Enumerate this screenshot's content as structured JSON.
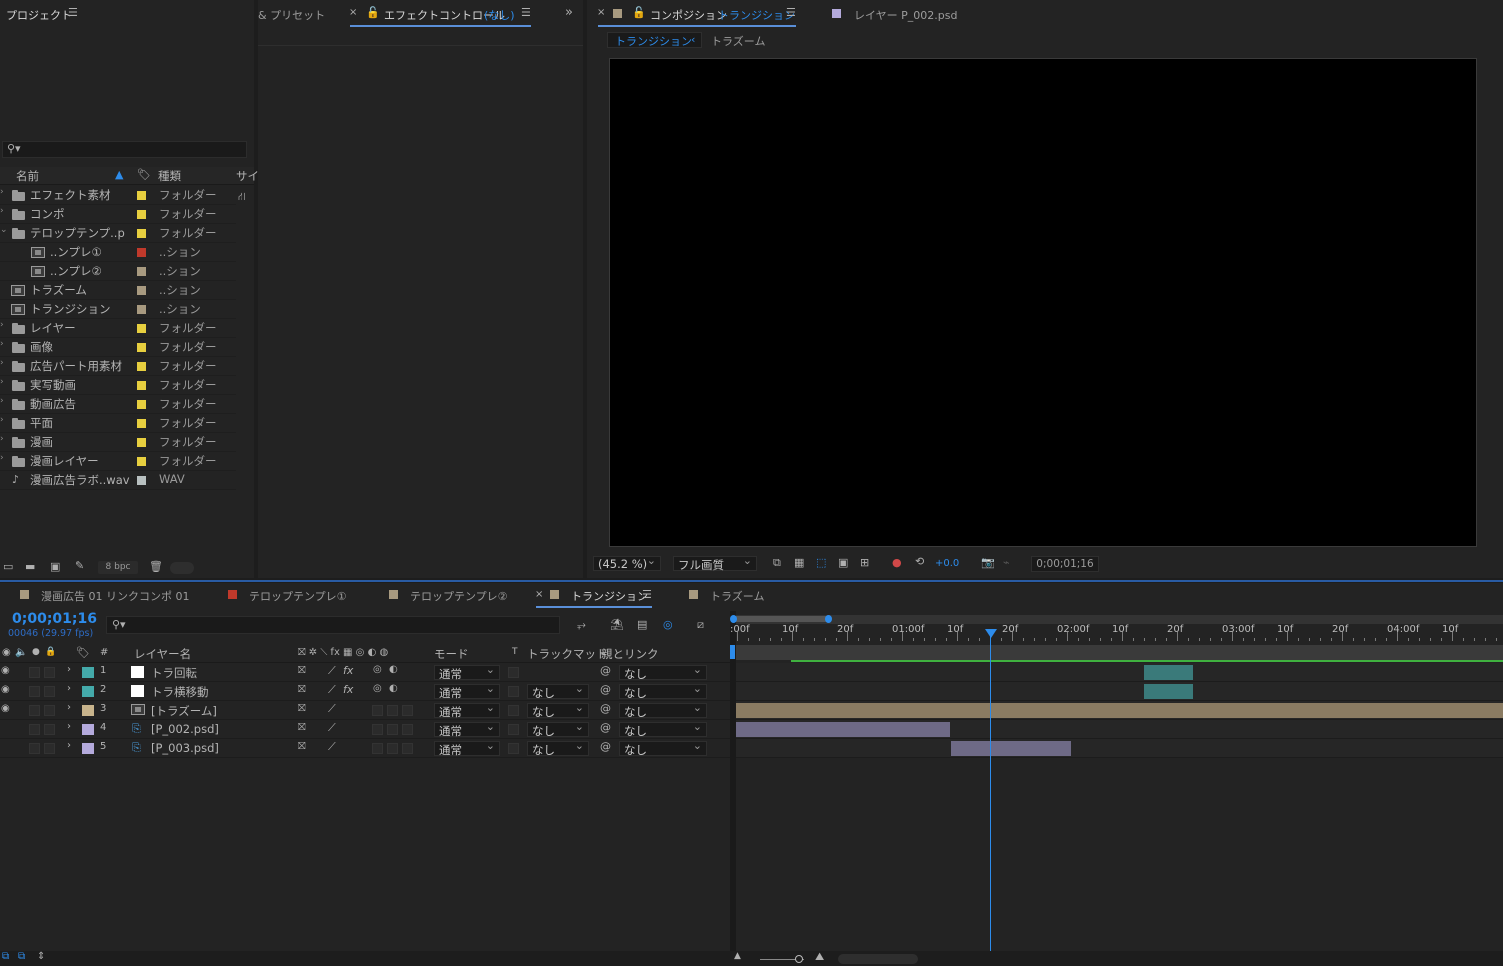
{
  "project": {
    "title": "プロジェクト",
    "columns": {
      "name": "名前",
      "type": "種類",
      "size": "サイ"
    },
    "items": [
      {
        "name": "エフェクト素材",
        "type": "フォルダー",
        "color": "#e7cf3f",
        "icon": "folder-icon",
        "indent": 0,
        "arrow": ">"
      },
      {
        "name": "コンポ",
        "type": "フォルダー",
        "color": "#e7cf3f",
        "icon": "folder-icon",
        "indent": 0,
        "arrow": ">"
      },
      {
        "name": "テロップテンプ..p",
        "type": "フォルダー",
        "color": "#e7cf3f",
        "icon": "folder-icon",
        "indent": 0,
        "arrow": "v"
      },
      {
        "name": "..ンプレ①",
        "type": "..ション",
        "color": "#c0392b",
        "icon": "composition-icon",
        "indent": 1,
        "arrow": ""
      },
      {
        "name": "..ンプレ②",
        "type": "..ション",
        "color": "#a89a80",
        "icon": "composition-icon",
        "indent": 1,
        "arrow": ""
      },
      {
        "name": "トラズーム",
        "type": "..ション",
        "color": "#a89a80",
        "icon": "composition-icon",
        "indent": 0,
        "arrow": ""
      },
      {
        "name": "トランジション",
        "type": "..ション",
        "color": "#a89a80",
        "icon": "composition-icon",
        "indent": 0,
        "arrow": ""
      },
      {
        "name": "レイヤー",
        "type": "フォルダー",
        "color": "#e7cf3f",
        "icon": "folder-icon",
        "indent": 0,
        "arrow": ">"
      },
      {
        "name": "画像",
        "type": "フォルダー",
        "color": "#e7cf3f",
        "icon": "folder-icon",
        "indent": 0,
        "arrow": ">"
      },
      {
        "name": "広告パート用素材",
        "type": "フォルダー",
        "color": "#e7cf3f",
        "icon": "folder-icon",
        "indent": 0,
        "arrow": ">"
      },
      {
        "name": "実写動画",
        "type": "フォルダー",
        "color": "#e7cf3f",
        "icon": "folder-icon",
        "indent": 0,
        "arrow": ">"
      },
      {
        "name": "動画広告",
        "type": "フォルダー",
        "color": "#e7cf3f",
        "icon": "folder-icon",
        "indent": 0,
        "arrow": ">"
      },
      {
        "name": "平面",
        "type": "フォルダー",
        "color": "#e7cf3f",
        "icon": "folder-icon",
        "indent": 0,
        "arrow": ">"
      },
      {
        "name": "漫画",
        "type": "フォルダー",
        "color": "#e7cf3f",
        "icon": "folder-icon",
        "indent": 0,
        "arrow": ">"
      },
      {
        "name": "漫画レイヤー",
        "type": "フォルダー",
        "color": "#e7cf3f",
        "icon": "folder-icon",
        "indent": 0,
        "arrow": ">"
      },
      {
        "name": "漫画広告ラボ..wav",
        "type": "WAV",
        "color": "#b8c0c0",
        "icon": "audio-file-icon",
        "indent": 0,
        "arrow": ""
      }
    ],
    "bpc": "8 bpc"
  },
  "effects": {
    "presets_tab": "& プリセット",
    "tab_label": "エフェクトコントロール",
    "tab_target": "(なし)"
  },
  "composition": {
    "tab_label": "コンポジション",
    "tab_comp": "トランジション",
    "layer_tab": "レイヤー P_002.psd",
    "breadcrumb_current": "トランジション",
    "breadcrumb_next": "トラズーム",
    "zoom": "(45.2 %)",
    "quality": "フル画質",
    "exposure": "+0.0",
    "timecode": "0;00;01;16"
  },
  "timeline": {
    "tabs": [
      {
        "label": "漫画広告 01 リンクコンポ 01",
        "color": "#a89a80",
        "active": false
      },
      {
        "label": "テロップテンプレ①",
        "color": "#c0392b",
        "active": false
      },
      {
        "label": "テロップテンプレ②",
        "color": "#a89a80",
        "active": false
      },
      {
        "label": "トランジション",
        "color": "#a89a80",
        "active": true
      },
      {
        "label": "トラズーム",
        "color": "#a89a80",
        "active": false
      }
    ],
    "timecode": "0;00;01;16",
    "frame_info": "00046 (29.97 fps)",
    "headers": {
      "num": "#",
      "layer_name": "レイヤー名",
      "mode": "モード",
      "t": "T",
      "trackmatte": "トラックマット",
      "parent": "親とリンク"
    },
    "ruler": [
      ":00f",
      "10f",
      "20f",
      "01:00f",
      "10f",
      "20f",
      "02:00f",
      "10f",
      "20f",
      "03:00f",
      "10f",
      "20f",
      "04:00f",
      "10f"
    ],
    "layers": [
      {
        "num": "1",
        "name": "トラ回転",
        "label_color": "#44aaaa",
        "kind": "solid",
        "mode": "通常",
        "matte": "",
        "parent": "なし",
        "eye": true,
        "fx": true
      },
      {
        "num": "2",
        "name": "トラ横移動",
        "label_color": "#44aaaa",
        "kind": "solid",
        "mode": "通常",
        "matte": "なし",
        "parent": "なし",
        "eye": true,
        "fx": true
      },
      {
        "num": "3",
        "name": "[トラズーム]",
        "label_color": "#c8b48c",
        "kind": "comp",
        "mode": "通常",
        "matte": "なし",
        "parent": "なし",
        "eye": true,
        "fx": false
      },
      {
        "num": "4",
        "name": "[P_002.psd]",
        "label_color": "#b4aadc",
        "kind": "psd",
        "mode": "通常",
        "matte": "なし",
        "parent": "なし",
        "eye": false,
        "fx": false
      },
      {
        "num": "5",
        "name": "[P_003.psd]",
        "label_color": "#b4aadc",
        "kind": "psd",
        "mode": "通常",
        "matte": "なし",
        "parent": "なし",
        "eye": false,
        "fx": false
      }
    ]
  }
}
